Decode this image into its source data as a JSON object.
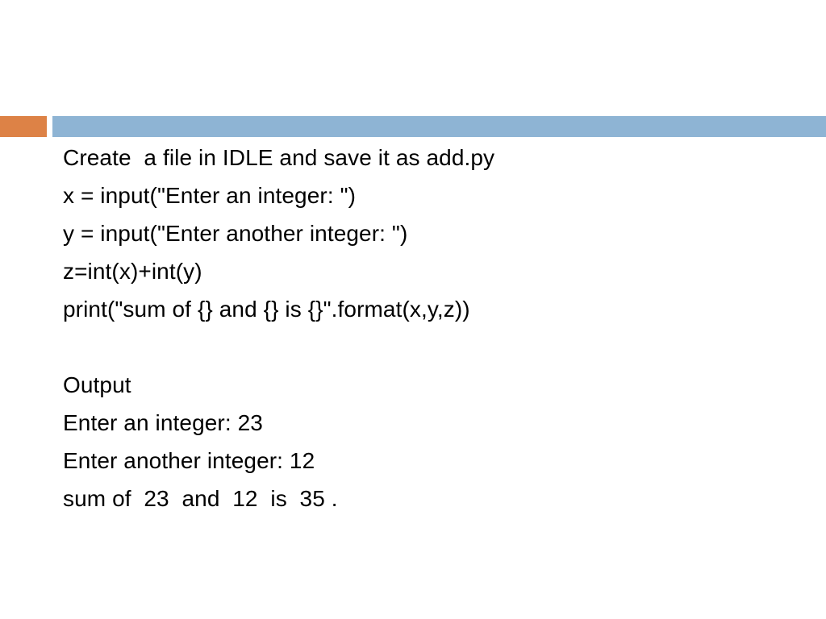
{
  "slide": {
    "accent_bar": {
      "orange_color": "#DD8246",
      "blue_color": "#8EB4D4"
    },
    "lines": [
      {
        "id": "instruction",
        "text": "Create  a file in IDLE and save it as add.py"
      },
      {
        "id": "code-x",
        "text": "x = input(\"Enter an integer: \")"
      },
      {
        "id": "code-y",
        "text": "y = input(\"Enter another integer: \")"
      },
      {
        "id": "code-z",
        "text": "z=int(x)+int(y)"
      },
      {
        "id": "code-print",
        "text": "print(\"sum of {} and {} is {}\".format(x,y,z))"
      },
      {
        "id": "spacer",
        "text": ""
      },
      {
        "id": "output-heading",
        "text": "Output"
      },
      {
        "id": "output-prompt-1",
        "text": "Enter an integer: 23"
      },
      {
        "id": "output-prompt-2",
        "text": "Enter another integer: 12"
      },
      {
        "id": "output-result",
        "text": "sum of  23  and  12  is  35 ."
      }
    ]
  }
}
